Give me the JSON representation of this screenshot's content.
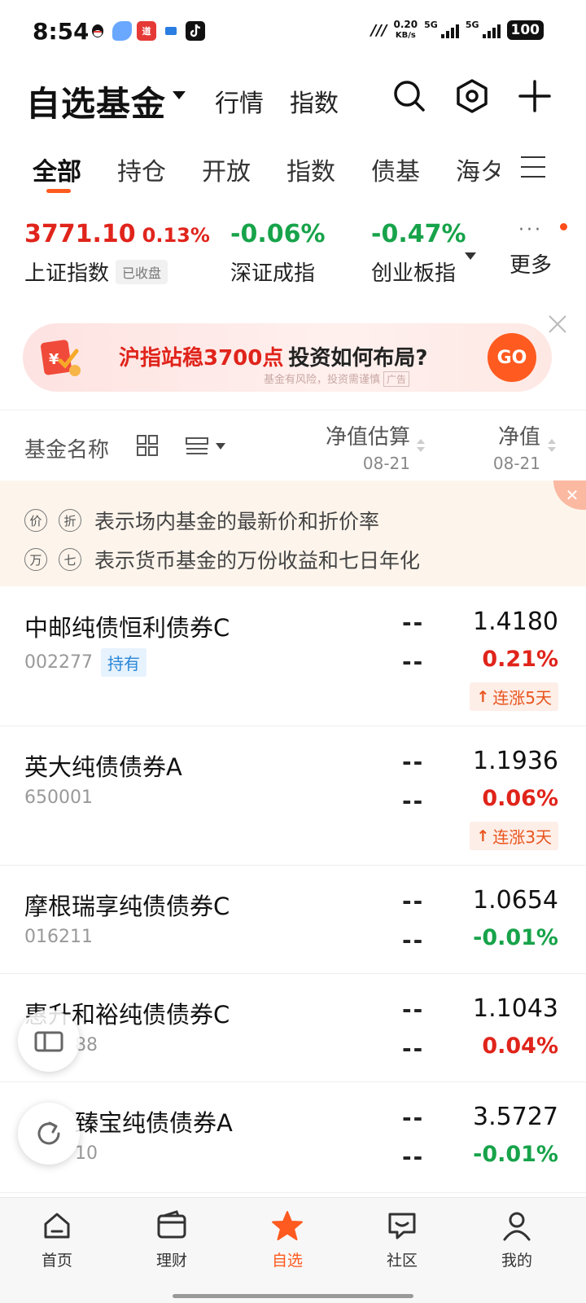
{
  "status_bar": {
    "time": "8:54",
    "net_speed": "0.20",
    "net_unit": "KB/s",
    "sim1": "5G",
    "sim2": "5G",
    "battery": "100"
  },
  "header": {
    "title": "自选基金",
    "links": [
      "行情",
      "指数"
    ],
    "icons": [
      "search-icon",
      "settings-hex-icon",
      "plus-icon"
    ]
  },
  "tabs": [
    "全部",
    "持仓",
    "开放",
    "指数",
    "债基",
    "海タ"
  ],
  "indices": [
    {
      "value": "3771.10",
      "pct": "0.13%",
      "name": "上证指数",
      "badge": "已收盘"
    },
    {
      "pct": "-0.06%",
      "name": "深证成指"
    },
    {
      "pct": "-0.47%",
      "name": "创业板指"
    },
    {
      "dots": "···",
      "name": "更多"
    }
  ],
  "banner": {
    "highlight": "沪指站稳3700点",
    "text": "投资如何布局?",
    "sub": "基金有风险，投资需谨慎",
    "ad": "广告",
    "go": "GO"
  },
  "list_header": {
    "name": "基金名称",
    "col_est": "净值估算",
    "col_est_date": "08-21",
    "col_nav": "净值",
    "col_nav_date": "08-21"
  },
  "tips": [
    {
      "a": "价",
      "b": "折",
      "text": "表示场内基金的最新价和折价率"
    },
    {
      "a": "万",
      "b": "七",
      "text": "表示货币基金的万份收益和七日年化"
    }
  ],
  "funds": [
    {
      "name": "中邮纯债恒利债券C",
      "code": "002277",
      "hold": "持有",
      "est1": "--",
      "est2": "--",
      "nav": "1.4180",
      "chg": "0.21%",
      "streak": "连涨5天"
    },
    {
      "name": "英大纯债债券A",
      "code": "650001",
      "est1": "--",
      "est2": "--",
      "nav": "1.1936",
      "chg": "0.06%",
      "streak": "连涨3天"
    },
    {
      "name": "摩根瑞享纯债债券C",
      "code": "016211",
      "est1": "--",
      "est2": "--",
      "nav": "1.0654",
      "chg": "-0.01%"
    },
    {
      "name": "惠升和裕纯债债券C",
      "code": "88",
      "est1": "--",
      "est2": "--",
      "nav": "1.1043",
      "chg": "0.04%"
    },
    {
      "name": "臻宝纯债债券A",
      "code": "10",
      "est1": "--",
      "est2": "--",
      "nav": "3.5727",
      "chg": "-0.01%"
    }
  ],
  "bottom_nav": [
    {
      "label": "首页",
      "icon": "home-icon"
    },
    {
      "label": "理财",
      "icon": "wallet-icon"
    },
    {
      "label": "自选",
      "icon": "star-icon"
    },
    {
      "label": "社区",
      "icon": "chat-icon"
    },
    {
      "label": "我的",
      "icon": "profile-icon"
    }
  ],
  "colors": {
    "accent": "#ff5a1f",
    "up": "#e0241b",
    "down": "#17a34a"
  }
}
